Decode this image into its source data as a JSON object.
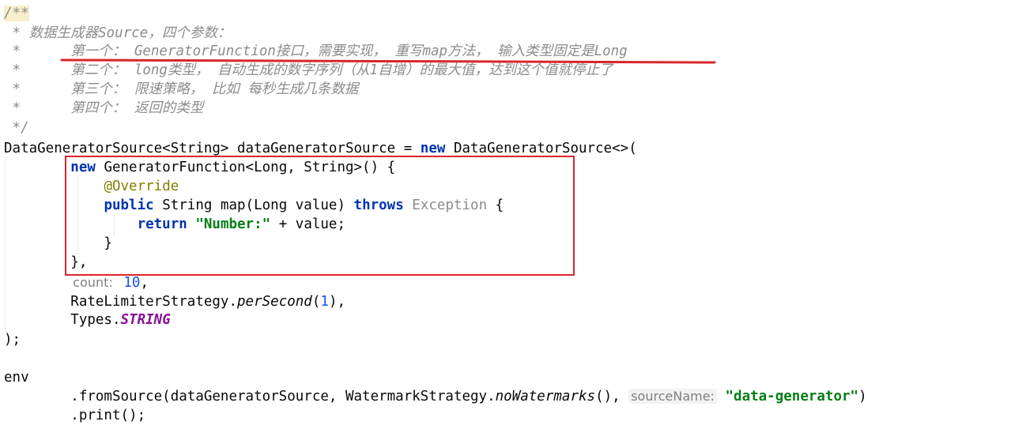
{
  "lines": [
    {
      "id": "l1",
      "tokens": [
        {
          "t": "/**",
          "cls": "c cbg"
        }
      ]
    },
    {
      "id": "l2",
      "tokens": [
        {
          "t": " * 数据生成器Source，四个参数：",
          "cls": "c"
        }
      ]
    },
    {
      "id": "l3",
      "tokens": [
        {
          "t": " *      第一个： GeneratorFunction接口，需要实现， 重写map方法， 输入类型固定是Long",
          "cls": "c"
        }
      ]
    },
    {
      "id": "l4",
      "tokens": [
        {
          "t": " *      第二个： long类型， 自动生成的数字序列（从1自增）的最大值，达到这个值就停止了",
          "cls": "c"
        }
      ]
    },
    {
      "id": "l5",
      "tokens": [
        {
          "t": " *      第三个： 限速策略， 比如 每秒生成几条数据",
          "cls": "c"
        }
      ]
    },
    {
      "id": "l6",
      "tokens": [
        {
          "t": " *      第四个： 返回的类型",
          "cls": "c"
        }
      ]
    },
    {
      "id": "l7",
      "tokens": [
        {
          "t": " */",
          "cls": "c"
        }
      ]
    },
    {
      "id": "l8",
      "tokens": [
        {
          "t": "DataGeneratorSource<String> dataGeneratorSource = ",
          "cls": ""
        },
        {
          "t": "new",
          "cls": "kw"
        },
        {
          "t": " DataGeneratorSource<>(",
          "cls": ""
        }
      ]
    },
    {
      "id": "l9",
      "tokens": [
        {
          "t": "        ",
          "cls": ""
        },
        {
          "t": "new",
          "cls": "kw"
        },
        {
          "t": " GeneratorFunction<Long, String>() {",
          "cls": ""
        }
      ]
    },
    {
      "id": "l10",
      "tokens": [
        {
          "t": "            ",
          "cls": ""
        },
        {
          "t": "@Override",
          "cls": "ann"
        }
      ]
    },
    {
      "id": "l11",
      "tokens": [
        {
          "t": "            ",
          "cls": ""
        },
        {
          "t": "public",
          "cls": "kw"
        },
        {
          "t": " String map(Long value) ",
          "cls": ""
        },
        {
          "t": "throws",
          "cls": "kw"
        },
        {
          "t": " ",
          "cls": ""
        },
        {
          "t": "Exception",
          "cls": "gray"
        },
        {
          "t": " {",
          "cls": ""
        }
      ]
    },
    {
      "id": "l12",
      "tokens": [
        {
          "t": "                ",
          "cls": ""
        },
        {
          "t": "return",
          "cls": "kw"
        },
        {
          "t": " ",
          "cls": ""
        },
        {
          "t": "\"Number:\"",
          "cls": "str"
        },
        {
          "t": " + value;",
          "cls": ""
        }
      ]
    },
    {
      "id": "l13",
      "tokens": [
        {
          "t": "            }",
          "cls": ""
        }
      ]
    },
    {
      "id": "l14",
      "tokens": [
        {
          "t": "        },",
          "cls": ""
        }
      ]
    },
    {
      "id": "l15",
      "tokens": [
        {
          "t": "        ",
          "cls": ""
        },
        {
          "t": "count:",
          "cls": "hint hint-count"
        },
        {
          "t": " ",
          "cls": ""
        },
        {
          "t": "10",
          "cls": "num"
        },
        {
          "t": ",",
          "cls": ""
        }
      ]
    },
    {
      "id": "l16",
      "tokens": [
        {
          "t": "        RateLimiterStrategy.",
          "cls": ""
        },
        {
          "t": "perSecond",
          "cls": "it"
        },
        {
          "t": "(",
          "cls": ""
        },
        {
          "t": "1",
          "cls": "num"
        },
        {
          "t": "),",
          "cls": ""
        }
      ]
    },
    {
      "id": "l17",
      "tokens": [
        {
          "t": "        Types.",
          "cls": ""
        },
        {
          "t": "STRING",
          "cls": "const"
        }
      ]
    },
    {
      "id": "l18",
      "tokens": [
        {
          "t": ");",
          "cls": ""
        }
      ]
    },
    {
      "id": "l19",
      "tokens": [
        {
          "t": "",
          "cls": ""
        }
      ]
    },
    {
      "id": "l20",
      "tokens": [
        {
          "t": "env",
          "cls": ""
        }
      ]
    },
    {
      "id": "l21",
      "tokens": [
        {
          "t": "        .fromSource(dataGeneratorSource, WatermarkStrategy.",
          "cls": ""
        },
        {
          "t": "noWatermarks",
          "cls": "it"
        },
        {
          "t": "(), ",
          "cls": ""
        },
        {
          "t": "sourceName:",
          "cls": "hint"
        },
        {
          "t": " ",
          "cls": ""
        },
        {
          "t": "\"data-generator\"",
          "cls": "str"
        },
        {
          "t": ")",
          "cls": ""
        }
      ]
    },
    {
      "id": "l22",
      "tokens": [
        {
          "t": "        .print();",
          "cls": ""
        }
      ]
    }
  ],
  "annotations": {
    "highlight_box_color": "#d8262e",
    "underline_color": "#d8262e"
  }
}
